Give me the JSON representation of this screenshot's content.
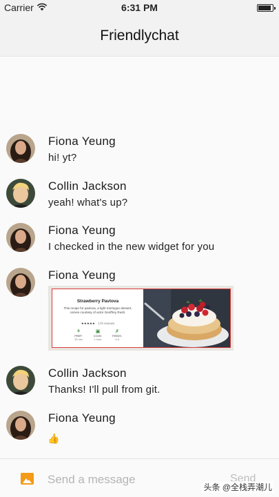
{
  "status_bar": {
    "carrier": "Carrier",
    "time": "6:31 PM"
  },
  "app_bar": {
    "title": "Friendlychat"
  },
  "messages": [
    {
      "sender": "Fiona Yeung",
      "text": "hi! yt?",
      "avatar": "fiona-avatar"
    },
    {
      "sender": "Collin Jackson",
      "text": "yeah! what's up?",
      "avatar": "collin-avatar"
    },
    {
      "sender": "Fiona Yeung",
      "text": "I checked in the new widget for you",
      "avatar": "fiona-avatar"
    },
    {
      "sender": "Fiona Yeung",
      "text": "",
      "avatar": "fiona-avatar"
    },
    {
      "sender": "Collin Jackson",
      "text": "Thanks! I'll pull from git.",
      "avatar": "collin-avatar"
    },
    {
      "sender": "Fiona Yeung",
      "text": "👍",
      "avatar": "fiona-avatar"
    }
  ],
  "recipe_card": {
    "title": "Strawberry Pavlova",
    "description": "This recipe for pavlova, a light meringue dessert, comes courtesy of actor Geoffrey Rush.",
    "stars": "★★★★★",
    "reviews": "170 reviews",
    "stats": [
      {
        "label": "PREP:",
        "value": "25 min",
        "icon": "prep-icon"
      },
      {
        "label": "COOK:",
        "value": "1 hour",
        "icon": "cook-icon"
      },
      {
        "label": "FEEDS:",
        "value": "4-6",
        "icon": "feeds-icon"
      }
    ]
  },
  "composer": {
    "placeholder": "Send a message",
    "send_label": "Send"
  },
  "watermark": "头条 @全栈弄潮儿",
  "colors": {
    "accent": "#f39a16",
    "card_border": "#d63a3a",
    "header_bg": "#f2f2f2"
  }
}
